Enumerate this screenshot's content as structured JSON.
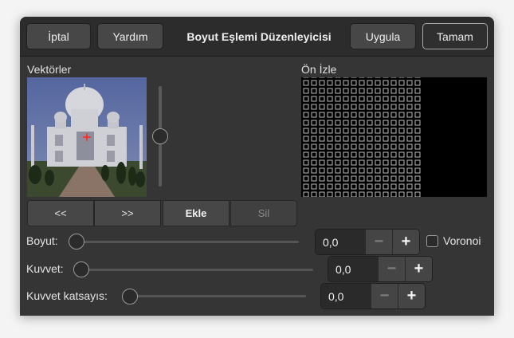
{
  "header": {
    "title": "Boyut Eşlemi Düzenleyicisi",
    "cancel_label": "İptal",
    "help_label": "Yardım",
    "apply_label": "Uygula",
    "ok_label": "Tamam"
  },
  "vectors": {
    "label": "Vektörler"
  },
  "preview": {
    "label": "Ön İzle"
  },
  "vector_nav": {
    "prev_label": "<<",
    "next_label": ">>",
    "add_label": "Ekle",
    "delete_label": "Sil"
  },
  "size": {
    "label": "Boyut:",
    "value": "0,0",
    "slider_fraction": 0.0
  },
  "voronoi": {
    "label": "Voronoi",
    "checked": false
  },
  "strength": {
    "label": "Kuvvet:",
    "value": "0,0",
    "slider_fraction": 0.0
  },
  "strength_exponent": {
    "label": "Kuvvet katsayıs:",
    "value": "0,0",
    "slider_fraction": 0.0
  },
  "spin_buttons": {
    "minus": "−",
    "plus": "+"
  },
  "icons": {
    "vector_marker": "red-crosshair-icon"
  }
}
